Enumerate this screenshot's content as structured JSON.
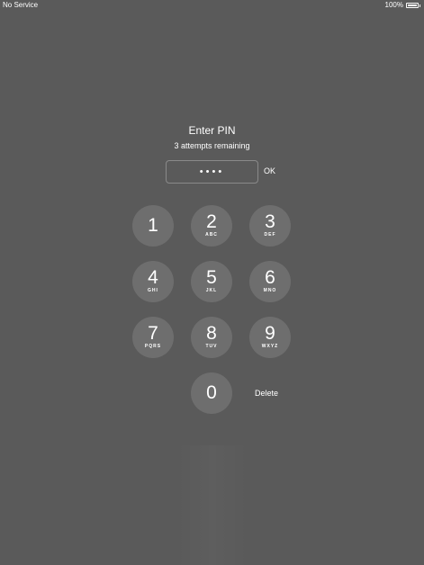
{
  "status_bar": {
    "carrier": "No Service",
    "battery_text": "100%",
    "battery_level": 1.0
  },
  "pin_prompt": {
    "title": "Enter PIN",
    "subtitle": "3 attempts remaining",
    "masked_value": "••••",
    "ok_label": "OK"
  },
  "keypad": {
    "keys": [
      {
        "digit": "1",
        "letters": ""
      },
      {
        "digit": "2",
        "letters": "ABC"
      },
      {
        "digit": "3",
        "letters": "DEF"
      },
      {
        "digit": "4",
        "letters": "GHI"
      },
      {
        "digit": "5",
        "letters": "JKL"
      },
      {
        "digit": "6",
        "letters": "MNO"
      },
      {
        "digit": "7",
        "letters": "PQRS"
      },
      {
        "digit": "8",
        "letters": "TUV"
      },
      {
        "digit": "9",
        "letters": "WXYZ"
      },
      {
        "digit": "0",
        "letters": ""
      }
    ],
    "delete_label": "Delete"
  },
  "colors": {
    "background": "#5a5a5a",
    "key_fill": "#6e6e6e",
    "text": "#ffffff"
  }
}
